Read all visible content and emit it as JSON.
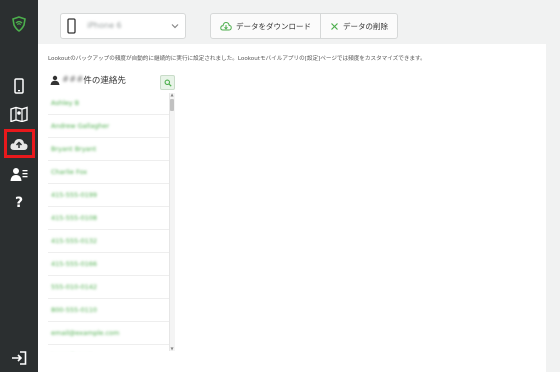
{
  "device": {
    "name": "iPhone 6"
  },
  "toolbar": {
    "download_label": "データをダウンロード",
    "delete_label": "データの削除"
  },
  "info_text": "Lookoutのバックアップの頻度が自動的に継続的に実行に設定されました。Lookoutモバイルアプリの[設定]ページでは頻度をカスタマイズできます。",
  "contacts": {
    "count": "###",
    "title_suffix": "件の連絡先",
    "items": [
      "Ashley B",
      "Andrew Gallagher",
      "Bryant Bryant",
      "Charlie Fox",
      "415-555-0199",
      "415-555-0108",
      "415-555-0132",
      "415-555-0166",
      "555-010-0142",
      "800-555-0110",
      "email@example.com",
      "Jason Bryant"
    ]
  },
  "colors": {
    "brand_green": "#4cae4c",
    "sidebar": "#2b2f30",
    "highlight": "#e8191c"
  },
  "icons": {
    "logo": "lookout-shield-icon",
    "phone": "phone-icon",
    "map": "map-icon",
    "cloud": "cloud-upload-icon",
    "contact": "contact-list-icon",
    "help": "question-icon",
    "logout": "logout-icon"
  }
}
